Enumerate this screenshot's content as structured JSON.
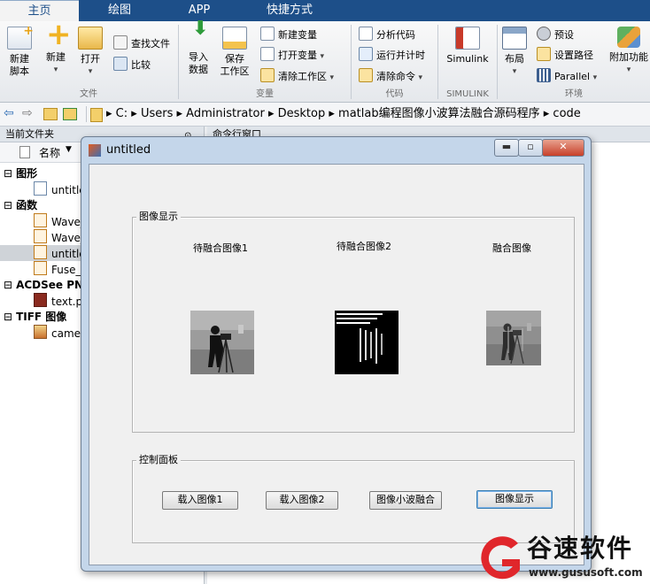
{
  "tabs": [
    {
      "label": "主页",
      "active": true
    },
    {
      "label": "绘图",
      "active": false
    },
    {
      "label": "APP",
      "active": false
    },
    {
      "label": "快捷方式",
      "active": false
    }
  ],
  "ribbon": {
    "file": {
      "new_script": "新建\n脚本",
      "new": "新建",
      "open": "打开",
      "find_files": "查找文件",
      "compare": "比较",
      "group": "文件"
    },
    "variable": {
      "import": "导入\n数据",
      "save_ws": "保存\n工作区",
      "new_var": "新建变量",
      "open_var": "打开变量",
      "clear_ws": "清除工作区",
      "group": "变量"
    },
    "code": {
      "analyze": "分析代码",
      "run_time": "运行并计时",
      "clear_cmd": "清除命令",
      "group": "代码"
    },
    "simulink": {
      "label": "Simulink",
      "group": "SIMULINK"
    },
    "environment": {
      "layout": "布局",
      "prefs": "预设",
      "set_path": "设置路径",
      "parallel": "Parallel",
      "addons": "附加功能",
      "group": "环境"
    }
  },
  "address": {
    "parts": [
      "C:",
      "Users",
      "Administrator",
      "Desktop",
      "matlab编程图像小波算法融合源码程序",
      "code"
    ]
  },
  "left_panel": {
    "title": "当前文件夹",
    "column": "名称",
    "groups": [
      {
        "label": "图形",
        "items": [
          "untitle"
        ]
      },
      {
        "label": "函数",
        "items": [
          "Wave_",
          "Wave_",
          "untitle",
          "Fuse_F"
        ]
      },
      {
        "label": "ACDSee PNG",
        "items": [
          "text.pn"
        ]
      },
      {
        "label": "TIFF 图像",
        "items": [
          "camer"
        ]
      }
    ]
  },
  "cmd_window": {
    "title": "命令行窗口"
  },
  "figure": {
    "title": "untitled",
    "display_panel": {
      "legend": "图像显示",
      "label1": "待融合图像1",
      "label2": "待融合图像2",
      "label3": "融合图像"
    },
    "control_panel": {
      "legend": "控制面板",
      "btn1": "载入图像1",
      "btn2": "载入图像2",
      "btn3": "图像小波融合",
      "btn4": "图像显示"
    }
  },
  "watermark": {
    "brand": "谷速软件",
    "url": "www.gususoft.com"
  },
  "colors": {
    "tab_bar": "#1d4f89",
    "watermark_red": "#e0262b"
  }
}
